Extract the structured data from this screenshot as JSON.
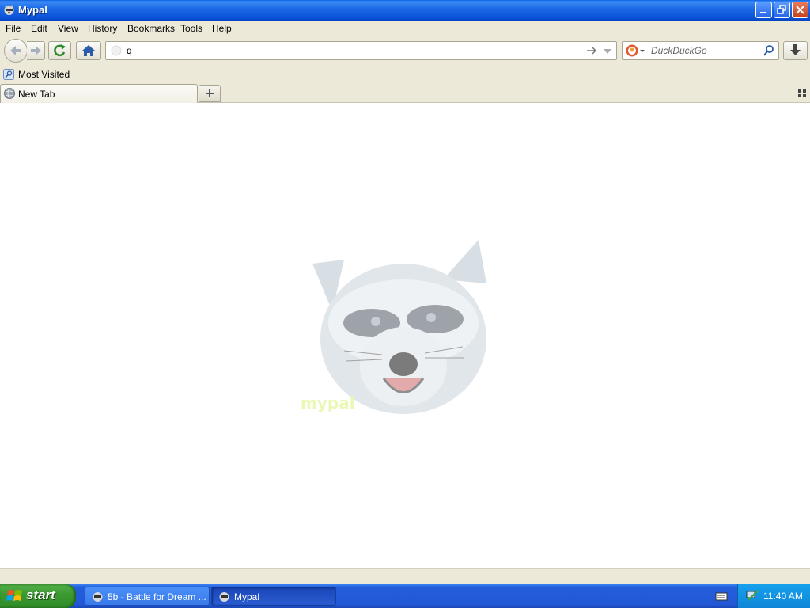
{
  "window": {
    "title": "Mypal"
  },
  "menu": {
    "file": "File",
    "edit": "Edit",
    "view": "View",
    "history": "History",
    "bookmarks": "Bookmarks",
    "tools": "Tools",
    "help": "Help"
  },
  "navbar": {
    "url_value": "q",
    "search_placeholder": "DuckDuckGo"
  },
  "bookmarks": {
    "most_visited": "Most Visited"
  },
  "tabs": [
    {
      "label": "New Tab"
    }
  ],
  "logo": {
    "text": "mypal"
  },
  "taskbar": {
    "start_label": "start",
    "tasks": [
      {
        "label": "5b - Battle for Dream ..."
      },
      {
        "label": "Mypal"
      }
    ],
    "clock": "11:40 AM"
  },
  "colors": {
    "titlebar": "#0a52d8",
    "chrome": "#ece9d8",
    "taskbar": "#245edb",
    "start": "#3c9a32",
    "tray": "#0f86d8"
  },
  "icons": [
    "raccoon-app-icon",
    "minimize-icon",
    "restore-icon",
    "close-icon",
    "back-arrow-icon",
    "forward-arrow-icon",
    "reload-icon",
    "home-icon",
    "go-arrow-icon",
    "dropdown-icon",
    "duckduckgo-icon",
    "search-icon",
    "download-icon",
    "most-visited-icon",
    "globe-icon",
    "plus-icon",
    "tab-grid-icon",
    "windows-flag-icon",
    "keyboard-icon",
    "network-icon"
  ]
}
